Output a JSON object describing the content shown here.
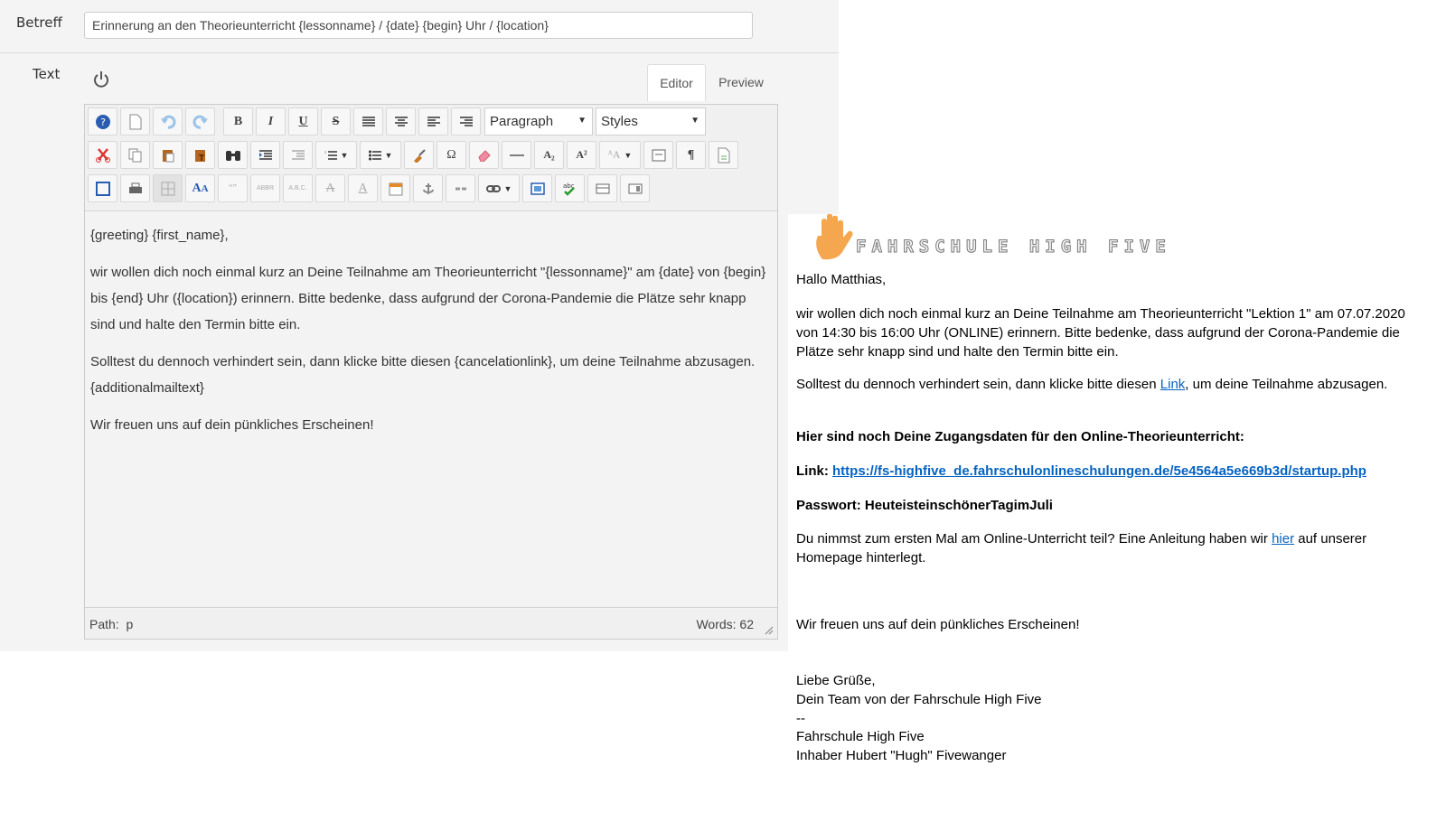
{
  "form": {
    "betreff_label": "Betreff",
    "text_label": "Text",
    "subject_value": "Erinnerung an den Theorieunterricht {lessonname} / {date} {begin} Uhr / {location}"
  },
  "tabs": {
    "editor": "Editor",
    "preview": "Preview"
  },
  "toolbar": {
    "format_select": "Paragraph",
    "styles_select": "Styles"
  },
  "editor_content": {
    "p1": "{greeting} {first_name},",
    "p2": "wir wollen dich noch einmal kurz an Deine Teilnahme am Theorieunterricht \"{lessonname}\" am {date} von {begin} bis {end} Uhr ({location}) erinnern. Bitte bedenke, dass aufgrund der Corona-Pandemie die Plätze sehr knapp sind und halte den Termin bitte ein.",
    "p3": "Solltest du dennoch verhindert sein, dann klicke bitte diesen {cancelationlink}, um deine Teilnahme abzusagen. {additionalmailtext}",
    "p4": "Wir freuen uns auf dein pünkliches Erscheinen!"
  },
  "statusbar": {
    "path_label": "Path:",
    "path_value": "p",
    "words": "Words: 62"
  },
  "preview": {
    "logo_text": "FAHRSCHULE HIGH FIVE",
    "greeting": "Hallo Matthias,",
    "para1": "wir wollen dich noch einmal kurz an Deine Teilnahme am Theorieunterricht \"Lektion 1\" am 07.07.2020 von 14:30 bis 16:00 Uhr (ONLINE) erinnern. Bitte bedenke, dass aufgrund der Corona-Pandemie die Plätze sehr knapp sind und halte den Termin bitte ein.",
    "para2_before": "Solltest du dennoch verhindert sein, dann klicke bitte diesen ",
    "para2_link": "Link",
    "para2_after": ", um deine Teilnahme abzusagen.",
    "access_heading": "Hier sind noch Deine Zugangsdaten für den Online-Theorieunterricht:",
    "link_label": "Link: ",
    "link_url": "https://fs-highfive_de.fahrschulonlineschulungen.de/5e4564a5e669b3d/startup.php",
    "password": "Passwort: HeuteisteinschönerTagimJuli",
    "para3_before": "Du nimmst zum ersten Mal am Online-Unterricht teil? Eine Anleitung haben wir ",
    "para3_link": "hier",
    "para3_after": " auf unserer Homepage hinterlegt.",
    "closing": "Wir freuen uns auf dein pünkliches Erscheinen!",
    "sig1": "Liebe Grüße,",
    "sig2": "Dein Team von der Fahrschule High Five",
    "sig3": "--",
    "sig4": "Fahrschule High Five",
    "sig5": "Inhaber Hubert \"Hugh\" Fivewanger"
  },
  "colors": {
    "link": "#0563c1",
    "logo_hand": "#f5a74f"
  }
}
